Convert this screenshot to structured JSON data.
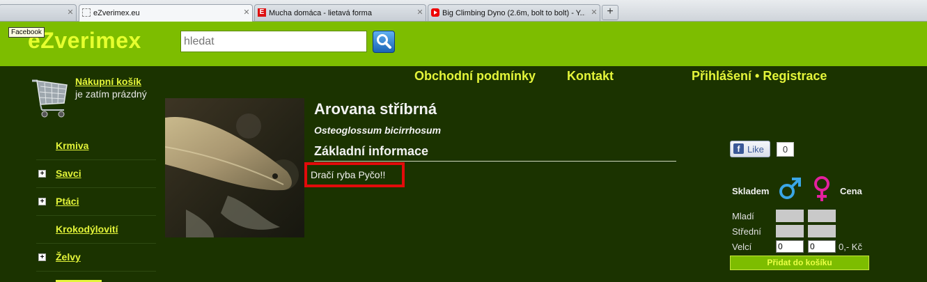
{
  "browser": {
    "tabs": [
      {
        "title": "",
        "favicon": "blank-icon"
      },
      {
        "title": "eZverimex.eu",
        "favicon": "blank-page-icon"
      },
      {
        "title": "Mucha domáca - lietavá forma",
        "favicon": "e-logo-icon"
      },
      {
        "title": "Big Climbing Dyno (2.6m, bolt to bolt) - Y...",
        "favicon": "youtube-icon"
      }
    ],
    "new_tab": "+",
    "tooltip": "Facebook"
  },
  "header": {
    "logo": "eZverimex",
    "search_placeholder": "hledat"
  },
  "nav": {
    "terms": "Obchodní podmínky",
    "contact": "Kontakt",
    "login": "Přihlášení • Registrace"
  },
  "cart": {
    "link": "Nákupní košík",
    "status": "je zatím prázdný"
  },
  "sidebar": {
    "items": [
      {
        "label": "Krmiva",
        "expandable": false
      },
      {
        "label": "Savci",
        "expandable": true
      },
      {
        "label": "Ptáci",
        "expandable": true
      },
      {
        "label": "Krokodýlovití",
        "expandable": false
      },
      {
        "label": "Želvy",
        "expandable": true
      }
    ]
  },
  "product": {
    "name": "Arovana stříbrná",
    "latin": "Osteoglossum bicirrhosum",
    "info_heading": "Základní informace",
    "description": "Dračí ryba Pyčo!!"
  },
  "like": {
    "label": "Like",
    "count": "0"
  },
  "stock": {
    "stock_label": "Skladem",
    "price_label": "Cena",
    "rows": [
      {
        "label": "Mladí"
      },
      {
        "label": "Střední"
      },
      {
        "label": "Velcí",
        "male_qty": "0",
        "female_qty": "0",
        "price": "0,- Kč"
      }
    ],
    "add_button": "Přidat do košíku"
  },
  "colors": {
    "header_green": "#7dbd00",
    "page_bg": "#1b3300",
    "link_yellow": "#e4f53a",
    "male_blue": "#3aa6e6",
    "female_pink": "#e3209e"
  }
}
